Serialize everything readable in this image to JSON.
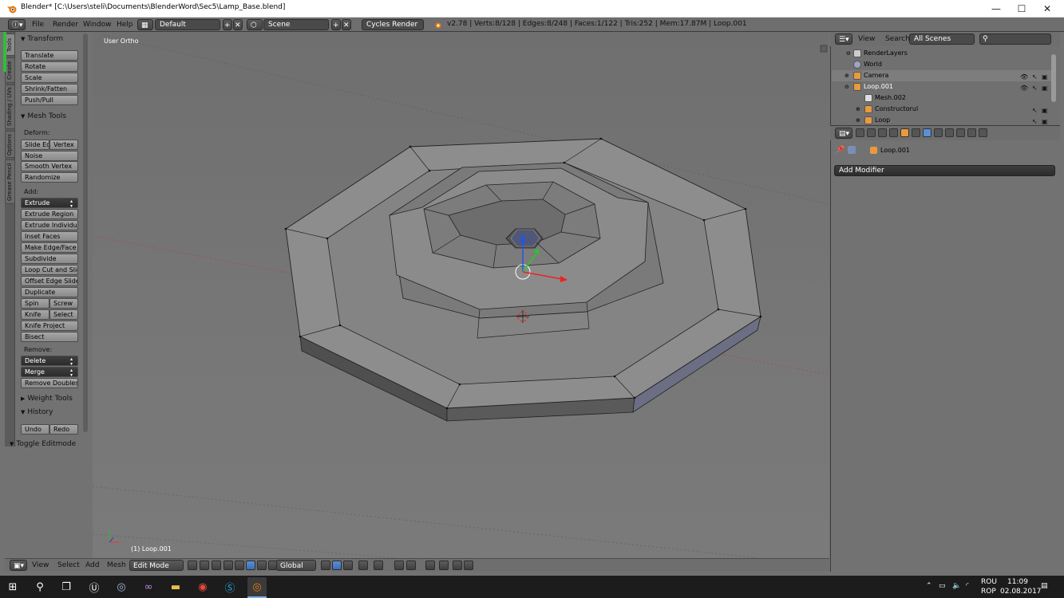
{
  "window": {
    "title": "Blender* [C:\\Users\\steli\\Documents\\BlenderWord\\Sec5\\Lamp_Base.blend]",
    "minimize": "—",
    "maximize": "☐",
    "close": "✕"
  },
  "info_header": {
    "menus": [
      "File",
      "Render",
      "Window",
      "Help"
    ],
    "layout": "Default",
    "scene": "Scene",
    "engine": "Cycles Render",
    "stats": "v2.78 | Verts:8/128 | Edges:8/248 | Faces:1/122 | Tris:252 | Mem:17.87M | Loop.001"
  },
  "left_tabs": [
    "Tools",
    "Create",
    "Shading / UVs",
    "Options",
    "Grease Pencil"
  ],
  "tool_shelf": {
    "transform_header": "Transform",
    "transform": [
      "Translate",
      "Rotate",
      "Scale",
      "Shrink/Fatten",
      "Push/Pull"
    ],
    "mesh_tools_header": "Mesh Tools",
    "deform_label": "Deform:",
    "slide_edge": "Slide Ed",
    "vertex": "Vertex",
    "noise": "Noise",
    "smooth_vertex": "Smooth Vertex",
    "randomize": "Randomize",
    "add_label": "Add:",
    "extrude": "Extrude",
    "extrude_region": "Extrude Region",
    "extrude_individual": "Extrude Individual",
    "inset_faces": "Inset Faces",
    "make_edge_face": "Make Edge/Face",
    "subdivide": "Subdivide",
    "loop_cut": "Loop Cut and Slide",
    "offset_edge": "Offset Edge Slide",
    "duplicate": "Duplicate",
    "spin": "Spin",
    "screw": "Screw",
    "knife": "Knife",
    "select": "Select",
    "knife_project": "Knife Project",
    "bisect": "Bisect",
    "remove_label": "Remove:",
    "delete": "Delete",
    "merge": "Merge",
    "remove_doubles": "Remove Doubles",
    "weight_tools_header": "Weight Tools",
    "history_header": "History",
    "undo": "Undo",
    "redo": "Redo",
    "toggle_editmode": "Toggle Editmode"
  },
  "viewport": {
    "view_name": "User Ortho",
    "object_label": "(1) Loop.001"
  },
  "bottom_header": {
    "menus": [
      "View",
      "Select",
      "Add",
      "Mesh"
    ],
    "mode": "Edit Mode",
    "orientation": "Global"
  },
  "outliner": {
    "view": "View",
    "search": "Search",
    "scenes": "All Scenes",
    "items": [
      "RenderLayers",
      "World",
      "Camera",
      "Loop.001",
      "Mesh.002",
      "Constructorul",
      "Loop"
    ]
  },
  "properties": {
    "breadcrumb": "Loop.001",
    "add_modifier": "Add Modifier"
  },
  "taskbar": {
    "lang1": "ROU",
    "lang2": "ROP",
    "time": "11:09",
    "date": "02.08.2017"
  },
  "colors": {
    "active_blue": "#5a8fd6",
    "blender_orange": "#e87d0d",
    "tab_green": "#2fbf3a"
  }
}
